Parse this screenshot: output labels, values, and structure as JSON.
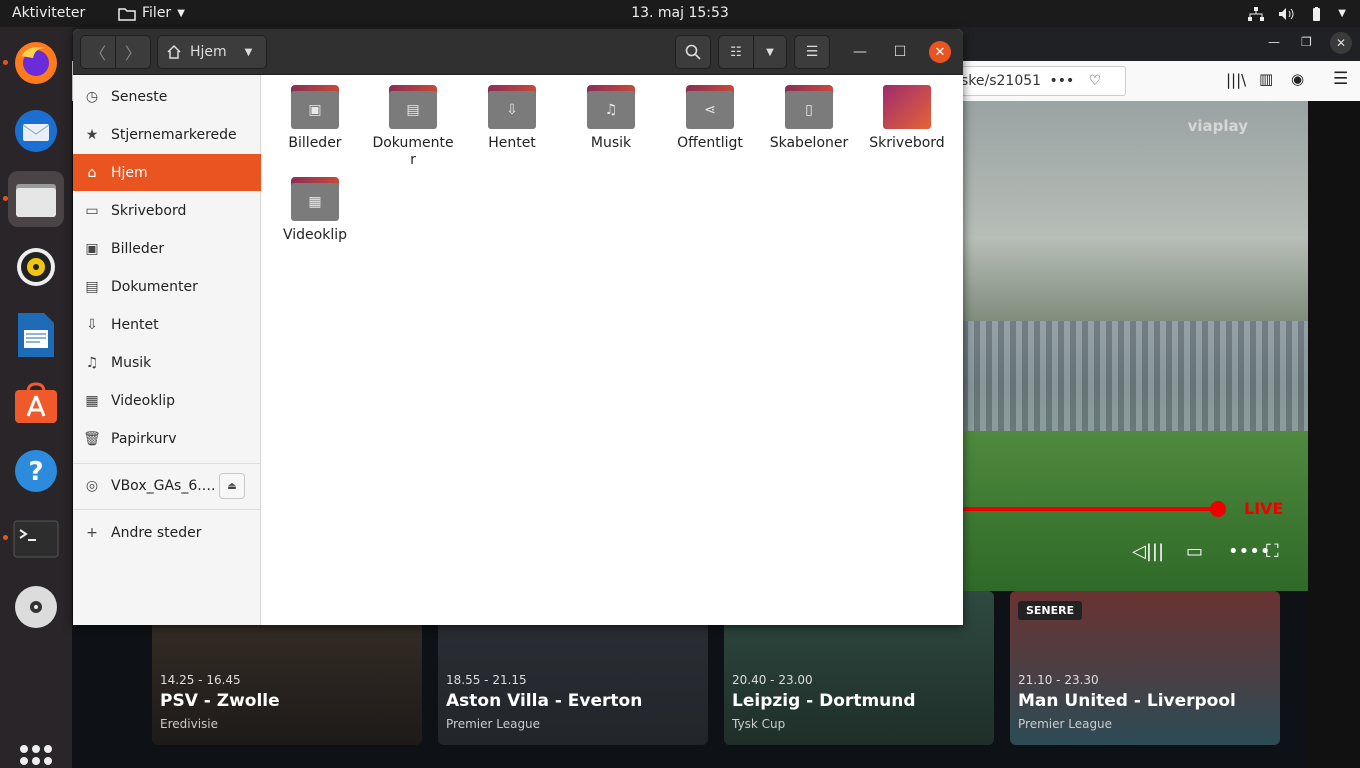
{
  "topbar": {
    "activities": "Aktiviteter",
    "app_menu": "Filer",
    "clock": "13. maj  15:53"
  },
  "browser": {
    "url_fragment": "ske/s21051",
    "url_more": "•••",
    "video": {
      "watermark": "viaplay",
      "live_label": "LIVE",
      "progress": 0.74
    },
    "cards": [
      {
        "time": "14.25 - 16.45",
        "title": "PSV - Zwolle",
        "league": "Eredivisie",
        "badge": ""
      },
      {
        "time": "18.55 - 21.15",
        "title": "Aston Villa - Everton",
        "league": "Premier League",
        "badge": ""
      },
      {
        "time": "20.40 - 23.00",
        "title": "Leipzig - Dortmund",
        "league": "Tysk Cup",
        "badge": ""
      },
      {
        "time": "21.10 - 23.30",
        "title": "Man United - Liverpool",
        "league": "Premier League",
        "badge": "SENERE"
      }
    ]
  },
  "nautilus": {
    "path_label": "Hjem",
    "sidebar": {
      "items": [
        {
          "label": "Seneste",
          "icon": "clock-icon"
        },
        {
          "label": "Stjernemarkerede",
          "icon": "star-icon"
        },
        {
          "label": "Hjem",
          "icon": "home-icon",
          "active": true
        },
        {
          "label": "Skrivebord",
          "icon": "desktop-icon"
        },
        {
          "label": "Billeder",
          "icon": "image-icon"
        },
        {
          "label": "Dokumenter",
          "icon": "document-icon"
        },
        {
          "label": "Hentet",
          "icon": "download-icon"
        },
        {
          "label": "Musik",
          "icon": "music-icon"
        },
        {
          "label": "Videoklip",
          "icon": "video-icon"
        },
        {
          "label": "Papirkurv",
          "icon": "trash-icon"
        }
      ],
      "device": {
        "label": "VBox_GAs_6.…",
        "icon": "disc-icon"
      },
      "other_places": "Andre steder"
    },
    "folders": [
      {
        "label": "Billeder",
        "icon": "image-icon"
      },
      {
        "label": "Dokumenter",
        "icon": "document-icon"
      },
      {
        "label": "Hentet",
        "icon": "download-icon"
      },
      {
        "label": "Musik",
        "icon": "music-icon"
      },
      {
        "label": "Offentligt",
        "icon": "share-icon"
      },
      {
        "label": "Skabeloner",
        "icon": "template-icon"
      },
      {
        "label": "Skrivebord",
        "icon": "desktop-icon"
      },
      {
        "label": "Videoklip",
        "icon": "video-icon"
      }
    ]
  },
  "colors": {
    "accent": "#e95420",
    "live": "#e00000"
  }
}
